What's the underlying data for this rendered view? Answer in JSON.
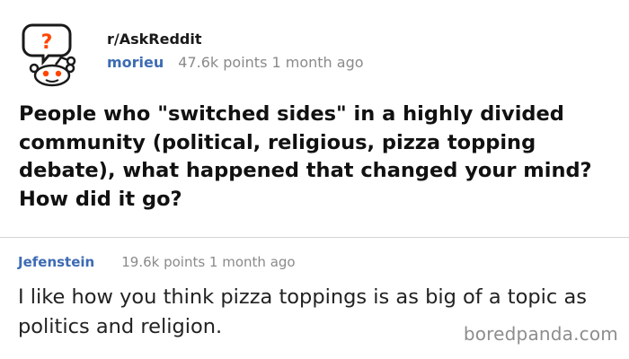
{
  "post": {
    "subreddit": "r/AskReddit",
    "author": "morieu",
    "points_time": "47.6k points 1 month ago",
    "title": "People who \"switched sides\" in a highly divided community (political, religious, pizza topping debate), what happened that changed your mind? How did it go?",
    "avatar_icon": "askreddit-snoo-icon"
  },
  "comment": {
    "author": "Jefenstein",
    "points_time": "19.6k points 1 month ago",
    "body": "I like how you think pizza toppings is as big of a topic as politics and religion."
  },
  "watermark": "boredpanda.com",
  "colors": {
    "username": "#3d6bb3",
    "meta_gray": "#8a8a8a",
    "icon_orange": "#ff4500",
    "divider": "#d4d4d4"
  }
}
